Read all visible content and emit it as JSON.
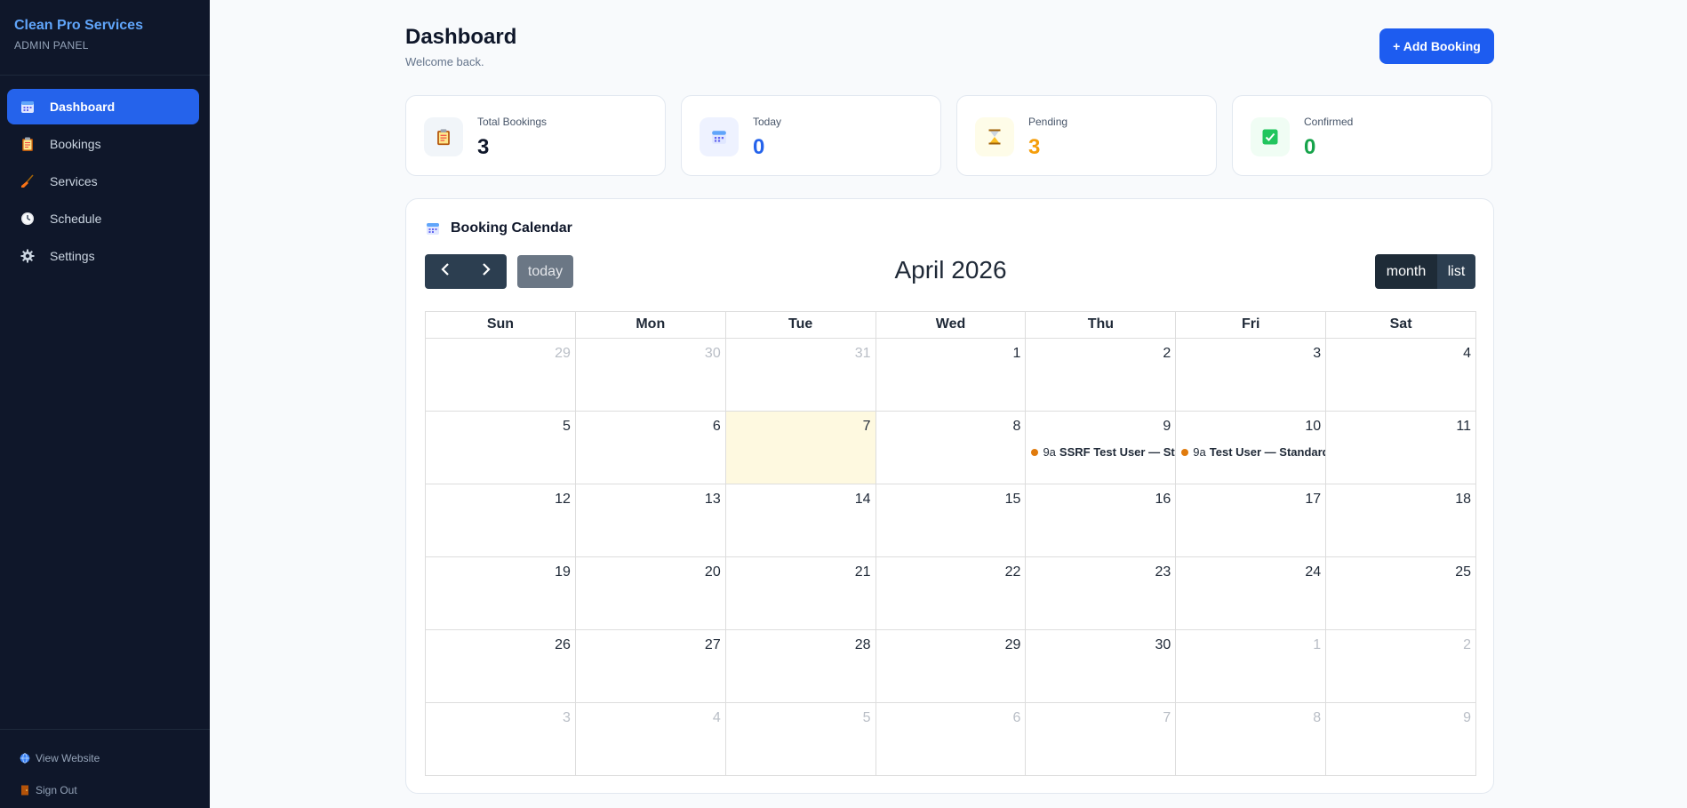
{
  "sidebar": {
    "brand": "Clean Pro Services",
    "subtitle": "ADMIN PANEL",
    "items": [
      {
        "label": "Dashboard",
        "icon": "calendar-icon",
        "active": true
      },
      {
        "label": "Bookings",
        "icon": "clipboard-icon",
        "active": false
      },
      {
        "label": "Services",
        "icon": "broom-icon",
        "active": false
      },
      {
        "label": "Schedule",
        "icon": "clock-icon",
        "active": false
      },
      {
        "label": "Settings",
        "icon": "gear-icon",
        "active": false
      }
    ],
    "footer": {
      "view_website": "View Website",
      "sign_out": "Sign Out"
    }
  },
  "header": {
    "title": "Dashboard",
    "subtitle": "Welcome back.",
    "add_button": "+ Add Booking"
  },
  "stats": [
    {
      "label": "Total Bookings",
      "value": "3",
      "icon": "clipboard-icon",
      "color": "#0f172a"
    },
    {
      "label": "Today",
      "value": "0",
      "icon": "calendar-icon",
      "color": "#2563eb"
    },
    {
      "label": "Pending",
      "value": "3",
      "icon": "hourglass-icon",
      "color": "#f59e0b"
    },
    {
      "label": "Confirmed",
      "value": "0",
      "icon": "checkbox-icon",
      "color": "#16a34a"
    }
  ],
  "calendar": {
    "heading": "Booking Calendar",
    "title": "April 2026",
    "today_label": "today",
    "view_month": "month",
    "view_list": "list",
    "weekdays": [
      "Sun",
      "Mon",
      "Tue",
      "Wed",
      "Thu",
      "Fri",
      "Sat"
    ],
    "weeks": [
      [
        "29",
        "30",
        "31",
        "1",
        "2",
        "3",
        "4"
      ],
      [
        "5",
        "6",
        "7",
        "8",
        "9",
        "10",
        "11"
      ],
      [
        "12",
        "13",
        "14",
        "15",
        "16",
        "17",
        "18"
      ],
      [
        "19",
        "20",
        "21",
        "22",
        "23",
        "24",
        "25"
      ],
      [
        "26",
        "27",
        "28",
        "29",
        "30",
        "1",
        "2"
      ],
      [
        "3",
        "4",
        "5",
        "6",
        "7",
        "8",
        "9"
      ]
    ],
    "events": {
      "thu": {
        "time": "9a",
        "title": "SSRF Test User — Standard"
      },
      "fri": {
        "time": "9a",
        "title": "Test User — Standard"
      }
    }
  }
}
